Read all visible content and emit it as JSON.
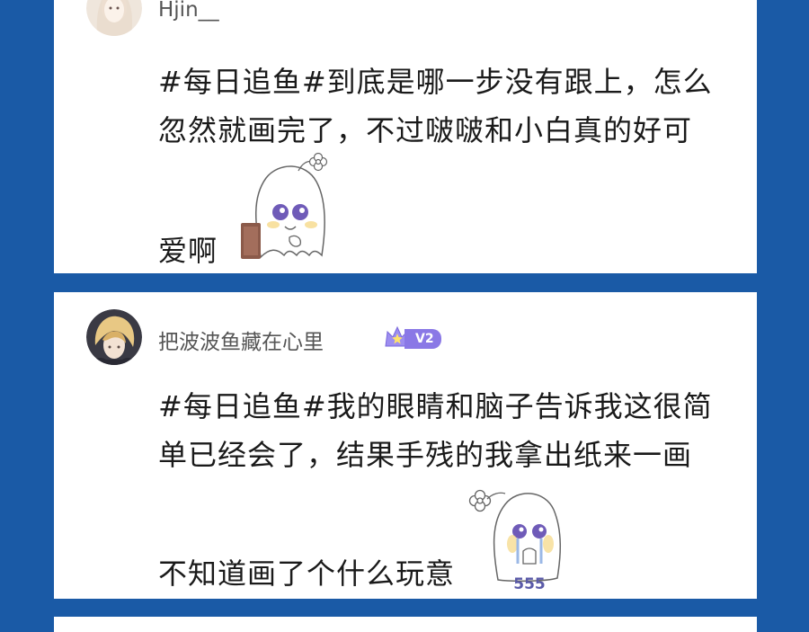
{
  "comments": [
    {
      "username": "Hjin__",
      "text_lines": [
        "#每日追鱼#到底是哪一步没有跟上，怎么",
        "忽然就画完了，不过啵啵和小白真的好可"
      ],
      "last_line": "爱啊",
      "sticker": "crying-ghost-holding-book-sticker"
    },
    {
      "username": "把波波鱼藏在心里",
      "badge": {
        "icon": "crown-icon",
        "level": "V2"
      },
      "text_lines": [
        "#每日追鱼#我的眼睛和脑子告诉我这很简",
        "单已经会了，结果手残的我拿出纸来一画"
      ],
      "last_line": "不知道画了个什么玩意",
      "sticker": {
        "name": "crying-ghost-555-sticker",
        "caption": "555"
      }
    }
  ],
  "colors": {
    "background": "#1a5aa6",
    "card": "#ffffff",
    "username": "#555555",
    "text": "#1a1a1a",
    "badge": "#8a78e6"
  }
}
